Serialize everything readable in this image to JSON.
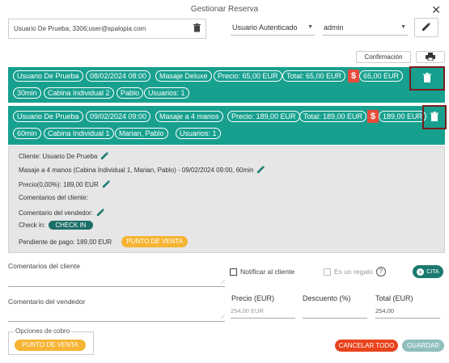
{
  "dialog": {
    "title": "Gestionar Reserva",
    "close_icon": "✕"
  },
  "top": {
    "user_value": "Usuario De Prueba; 3306;user@spalopia.com",
    "auth_select": "Usuario Autenticado",
    "admin_select": "admin"
  },
  "actions": {
    "confirm_label": "Confirmación"
  },
  "booking1": {
    "chips_row1": [
      "Usuario De Prueba",
      "08/02/2024 08:00",
      "Masaje Deluxe",
      "Precio: 65,00 EUR",
      "Total: 65,00 EUR"
    ],
    "pending": "65,00 EUR",
    "chips_row2": [
      "30min",
      "Cabina Individual 2",
      "Pablo",
      "Usuarios: 1"
    ]
  },
  "booking2": {
    "chips_row1": [
      "Usuario De Prueba",
      "09/02/2024 09:00",
      "Masaje a 4 manos",
      "Precio: 189,00 EUR",
      "Total: 189,00 EUR"
    ],
    "pending": "189,00 EUR",
    "chips_row2": [
      "60min",
      "Cabina Individual 1",
      "Marian, Pablo",
      "Usuarios: 1"
    ]
  },
  "details": {
    "cliente": "Cliente: Usuario De Prueba",
    "servicio": "Masaje a 4 manos (Cabina Individual 1, Marian, Pablo) - 09/02/2024 09:00, 60min",
    "precio": "Precio(0,00%): 189,00 EUR",
    "comentarios_cliente": "Comentarios del cliente:",
    "comentario_vendedor": "Comentario del vendedor:",
    "checkin_label": "Check in:",
    "checkin_button": "CHECK IN",
    "pendiente": "Pendiente de pago: 189,00 EUR",
    "punto_venta": "PUNTO DE VENTA"
  },
  "form": {
    "comentarios_cliente_label": "Comentarios del cliente",
    "comentario_vendedor_label": "Comentario del vendedor",
    "notificar_label": "Notificar al cliente",
    "regalo_label": "Es un regalo",
    "cita_label": "CITA",
    "precio_header": "Precio (EUR)",
    "descuento_header": "Descuento (%)",
    "total_header": "Total (EUR)",
    "precio_value": "254,00 EUR",
    "total_value": "254,00"
  },
  "footer": {
    "opciones_cobro": "Opciones de cobro",
    "punto_venta": "PUNTO DE VENTA",
    "cancelar": "CANCELAR TODO",
    "guardar": "GUARDAR"
  },
  "colors": {
    "teal": "#18a08f",
    "orange": "#f5b433",
    "red": "#e8431d",
    "dollar_red": "#e74c3c"
  }
}
